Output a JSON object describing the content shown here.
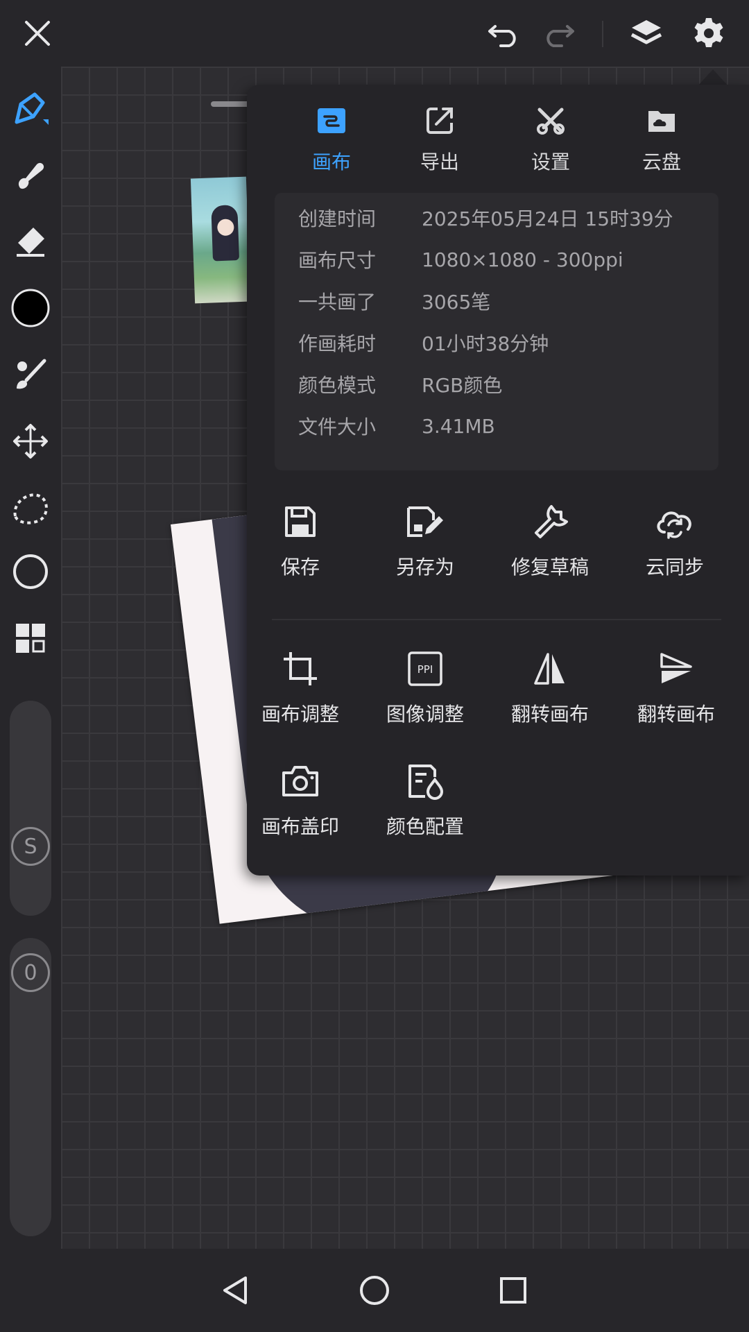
{
  "topbar": {
    "icons": [
      "close-icon",
      "undo-icon",
      "redo-icon",
      "layers-icon",
      "gear-icon"
    ]
  },
  "left_toolbar": {
    "tools": [
      "brush-icon",
      "smudge-icon",
      "eraser-icon",
      "color-swatch",
      "paint-bucket-icon",
      "move-icon",
      "lasso-icon",
      "shape-icon",
      "grid-icon"
    ],
    "size_label": "S",
    "opacity_label": "0",
    "current_color": "#000000",
    "accent": "#3da2ff"
  },
  "panel": {
    "tabs": [
      {
        "label": "画布",
        "icon": "canvas-icon",
        "active": true
      },
      {
        "label": "导出",
        "icon": "export-icon",
        "active": false
      },
      {
        "label": "设置",
        "icon": "tools-icon",
        "active": false
      },
      {
        "label": "云盘",
        "icon": "cloud-drive-icon",
        "active": false
      }
    ],
    "info": [
      {
        "key": "创建时间",
        "value": "2025年05月24日 15时39分"
      },
      {
        "key": "画布尺寸",
        "value": "1080×1080 - 300ppi"
      },
      {
        "key": "一共画了",
        "value": "3065笔"
      },
      {
        "key": "作画耗时",
        "value": "01小时38分钟"
      },
      {
        "key": "颜色模式",
        "value": "RGB颜色"
      },
      {
        "key": "文件大小",
        "value": "3.41MB"
      }
    ],
    "actions_top": [
      {
        "label": "保存",
        "icon": "save-icon"
      },
      {
        "label": "另存为",
        "icon": "save-as-icon"
      },
      {
        "label": "修复草稿",
        "icon": "wrench-icon"
      },
      {
        "label": "云同步",
        "icon": "cloud-sync-icon"
      }
    ],
    "actions_bottom": [
      {
        "label": "画布调整",
        "icon": "crop-icon"
      },
      {
        "label": "图像调整",
        "icon": "ppi-icon"
      },
      {
        "label": "翻转画布",
        "icon": "flip-horizontal-icon"
      },
      {
        "label": "翻转画布",
        "icon": "flip-vertical-icon"
      },
      {
        "label": "画布盖印",
        "icon": "camera-icon"
      },
      {
        "label": "颜色配置",
        "icon": "color-config-icon"
      }
    ]
  },
  "bottom_nav": {
    "icons": [
      "back-icon",
      "home-icon",
      "recents-icon"
    ]
  }
}
